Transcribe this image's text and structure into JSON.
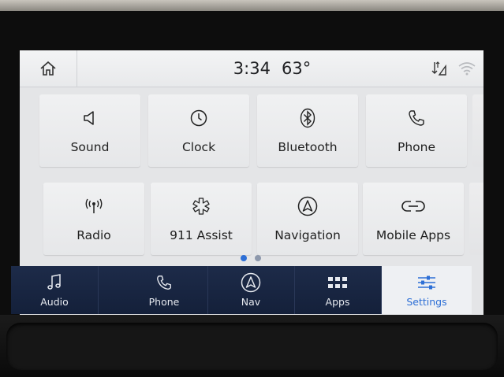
{
  "status": {
    "time": "3:34",
    "temperature": "63°"
  },
  "tiles": [
    {
      "label": "Sound",
      "icon": "speaker-icon"
    },
    {
      "label": "Clock",
      "icon": "clock-icon"
    },
    {
      "label": "Bluetooth",
      "icon": "bluetooth-icon"
    },
    {
      "label": "Phone",
      "icon": "phone-icon"
    },
    {
      "label": "Radio",
      "icon": "radio-icon"
    },
    {
      "label": "911 Assist",
      "icon": "911-assist-icon"
    },
    {
      "label": "Navigation",
      "icon": "navigation-icon"
    },
    {
      "label": "Mobile Apps",
      "icon": "mobile-apps-icon"
    }
  ],
  "pagination": {
    "current": 1,
    "total": 2
  },
  "navbar": [
    {
      "label": "Audio",
      "icon": "music-note-icon"
    },
    {
      "label": "Phone",
      "icon": "phone-icon"
    },
    {
      "label": "Nav",
      "icon": "navigation-icon"
    },
    {
      "label": "Apps",
      "icon": "apps-grid-icon"
    },
    {
      "label": "Settings",
      "icon": "settings-sliders-icon",
      "active": true
    }
  ],
  "colors": {
    "accent": "#2d6fd6",
    "navbar_bg": "#1b2846",
    "tile_bg": "#eeeff1"
  }
}
